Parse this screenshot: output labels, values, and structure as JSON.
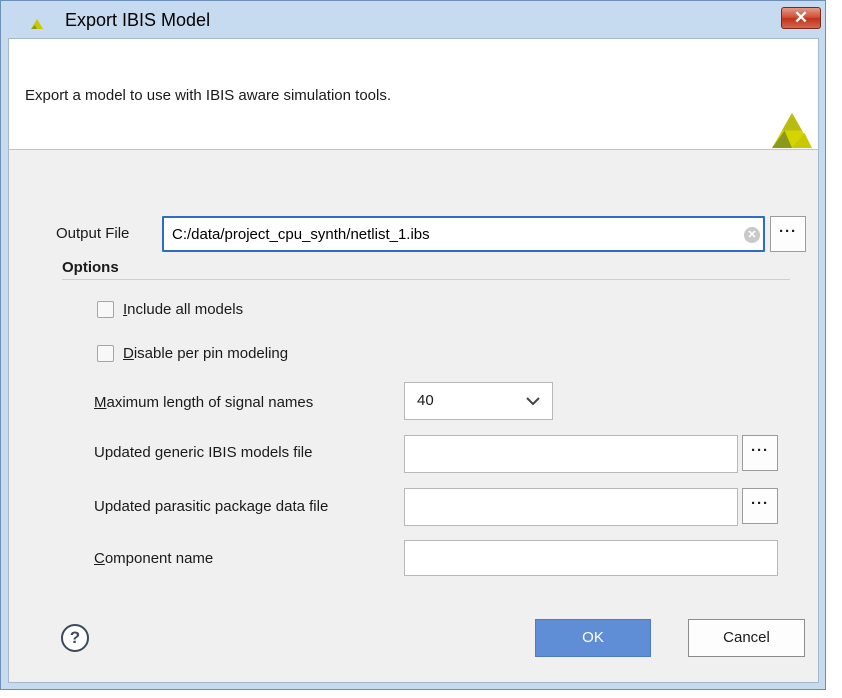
{
  "window": {
    "title": "Export IBIS Model",
    "close_label": "✕"
  },
  "header": {
    "description": "Export a model to use with IBIS aware simulation tools."
  },
  "output_file": {
    "label": "Output File",
    "value": "C:/data/project_cpu_synth/netlist_1.ibs",
    "browse_label": "···"
  },
  "options": {
    "title": "Options",
    "include_all_models": {
      "label_mnemonic": "I",
      "label_rest": "nclude all models",
      "checked": false
    },
    "disable_per_pin": {
      "label_mnemonic": "D",
      "label_rest": "isable per pin modeling",
      "checked": false
    },
    "max_length": {
      "label_mnemonic": "M",
      "label_rest": "aximum length of signal names",
      "selected": "40"
    },
    "generic_models": {
      "label": "Updated generic IBIS models file",
      "value": "",
      "browse_label": "···"
    },
    "parasitic_package": {
      "label": "Updated parasitic package data file",
      "value": "",
      "browse_label": "···"
    },
    "component_name": {
      "label_mnemonic": "C",
      "label_rest": "omponent name",
      "value": ""
    }
  },
  "footer": {
    "help_label": "?",
    "ok_label": "OK",
    "cancel_label": "Cancel"
  },
  "colors": {
    "ok_button": "#5f8ed6",
    "focus_border": "#2f6cc4",
    "logo_yellow": "#c8c800",
    "logo_olive": "#8a9a1a",
    "close_red": "#c0321a"
  }
}
